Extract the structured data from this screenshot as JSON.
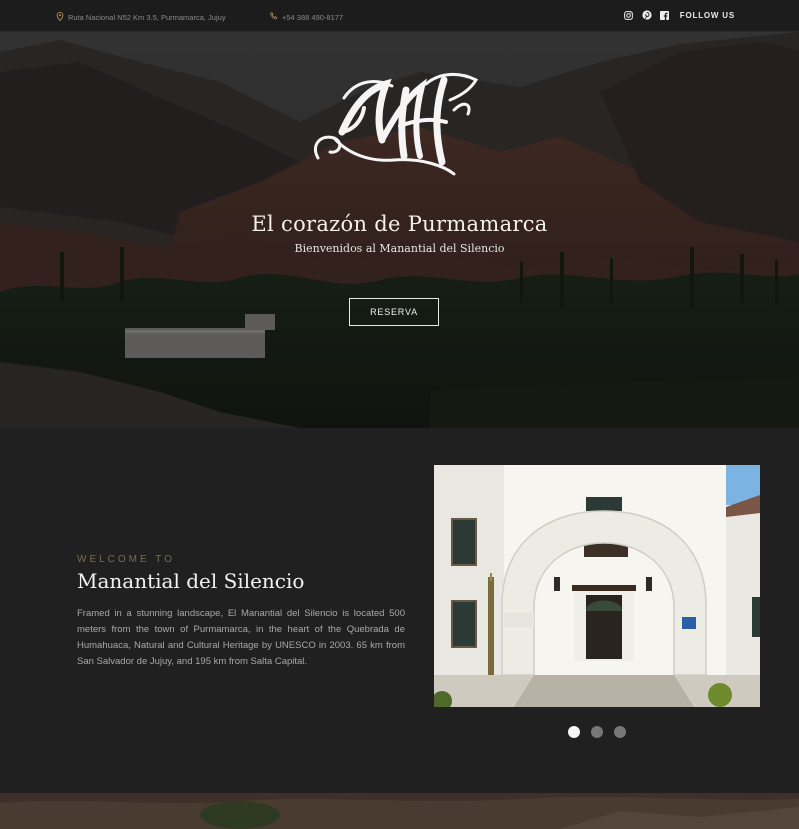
{
  "topbar": {
    "address": "Ruta Nacional N52 Km 3.5, Purmamarca, Jujuy",
    "phone": "+54 388 490-8177",
    "follow_label": "FOLLOW US",
    "social_icons": [
      "instagram-icon",
      "pinterest-icon",
      "facebook-icon"
    ]
  },
  "hero": {
    "logo_alt": "MdS monogram",
    "title": "El corazón de Purmamarca",
    "subtitle": "Bienvenidos al Manantial del Silencio",
    "button_label": "RESERVA"
  },
  "welcome": {
    "kicker": "WELCOME TO",
    "title": "Manantial del Silencio",
    "body": "Framed in a stunning landscape, El Manantial del Silencio is located 500 meters from the town of Purmamarca, in the heart of the Quebrada de Humahuaca, Natural and Cultural Heritage by UNESCO in 2003. 65 km from San Salvador de Jujuy, and 195 km from Salta Capital.",
    "carousel": {
      "slides": 3,
      "active": 1
    }
  },
  "colors": {
    "accent": "#b8925a",
    "background": "#202020",
    "topbar": "#1c1c1c"
  }
}
